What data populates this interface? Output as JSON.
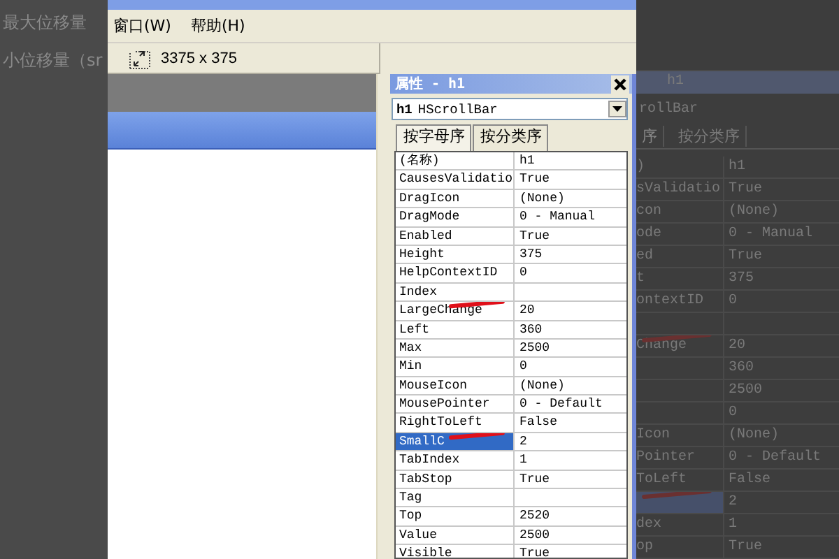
{
  "backdrop_left": {
    "lines": [
      "最大位移量",
      "小位移量（sr"
    ]
  },
  "menu": [
    "窗口(W)",
    "帮助(H)"
  ],
  "toolbar": {
    "size": "3375 x 375"
  },
  "properties": {
    "title": "属性 - h1",
    "object": "h1",
    "object_type": "HScrollBar",
    "tabs": [
      {
        "label": "按字母序",
        "selected": true
      },
      {
        "label": "按分类序",
        "selected": false
      }
    ],
    "rows": [
      {
        "name": "(名称)",
        "value": "h1",
        "selected": false,
        "marked": false
      },
      {
        "name": "CausesValidatio",
        "value": "True",
        "selected": false,
        "marked": false
      },
      {
        "name": "DragIcon",
        "value": "(None)",
        "selected": false,
        "marked": false
      },
      {
        "name": "DragMode",
        "value": "0 - Manual",
        "selected": false,
        "marked": false
      },
      {
        "name": "Enabled",
        "value": "True",
        "selected": false,
        "marked": false
      },
      {
        "name": "Height",
        "value": "375",
        "selected": false,
        "marked": false
      },
      {
        "name": "HelpContextID",
        "value": "0",
        "selected": false,
        "marked": false
      },
      {
        "name": "Index",
        "value": "",
        "selected": false,
        "marked": false
      },
      {
        "name": "LargeChange",
        "value": "20",
        "selected": false,
        "marked": true
      },
      {
        "name": "Left",
        "value": "360",
        "selected": false,
        "marked": false
      },
      {
        "name": "Max",
        "value": "2500",
        "selected": false,
        "marked": false
      },
      {
        "name": "Min",
        "value": "0",
        "selected": false,
        "marked": false
      },
      {
        "name": "MouseIcon",
        "value": "(None)",
        "selected": false,
        "marked": false
      },
      {
        "name": "MousePointer",
        "value": "0 - Default",
        "selected": false,
        "marked": false
      },
      {
        "name": "RightToLeft",
        "value": "False",
        "selected": false,
        "marked": false
      },
      {
        "name": "SmallC",
        "value": "2",
        "selected": true,
        "marked": true
      },
      {
        "name": "TabIndex",
        "value": "1",
        "selected": false,
        "marked": false
      },
      {
        "name": "TabStop",
        "value": "True",
        "selected": false,
        "marked": false
      },
      {
        "name": "Tag",
        "value": "",
        "selected": false,
        "marked": false
      },
      {
        "name": "Top",
        "value": "2520",
        "selected": false,
        "marked": false
      },
      {
        "name": "Value",
        "value": "2500",
        "selected": false,
        "marked": false
      },
      {
        "name": "Visible",
        "value": "True",
        "selected": false,
        "marked": false
      }
    ]
  },
  "backdrop_right": {
    "title": "h1",
    "object": "rollBar",
    "tabs": [
      {
        "label": "序",
        "selected": true
      },
      {
        "label": "按分类序",
        "selected": false
      }
    ],
    "rows": [
      {
        "name": ")",
        "value": "h1",
        "selected": false,
        "marked": false
      },
      {
        "name": "sValidatio",
        "value": "True",
        "selected": false,
        "marked": false
      },
      {
        "name": "con",
        "value": "(None)",
        "selected": false,
        "marked": false
      },
      {
        "name": "ode",
        "value": "0 - Manual",
        "selected": false,
        "marked": false
      },
      {
        "name": "ed",
        "value": "True",
        "selected": false,
        "marked": false
      },
      {
        "name": "t",
        "value": "375",
        "selected": false,
        "marked": false
      },
      {
        "name": "ontextID",
        "value": "0",
        "selected": false,
        "marked": false
      },
      {
        "name": "",
        "value": "",
        "selected": false,
        "marked": false
      },
      {
        "name": "Change",
        "value": "20",
        "selected": false,
        "marked": true
      },
      {
        "name": "",
        "value": "360",
        "selected": false,
        "marked": false
      },
      {
        "name": "",
        "value": "2500",
        "selected": false,
        "marked": false
      },
      {
        "name": "",
        "value": "0",
        "selected": false,
        "marked": false
      },
      {
        "name": "Icon",
        "value": "(None)",
        "selected": false,
        "marked": false
      },
      {
        "name": "Pointer",
        "value": "0 - Default",
        "selected": false,
        "marked": false
      },
      {
        "name": "ToLeft",
        "value": "False",
        "selected": false,
        "marked": false
      },
      {
        "name": "",
        "value": "2",
        "selected": true,
        "marked": true
      },
      {
        "name": "dex",
        "value": "1",
        "selected": false,
        "marked": false
      },
      {
        "name": "op",
        "value": "True",
        "selected": false,
        "marked": false
      }
    ]
  }
}
